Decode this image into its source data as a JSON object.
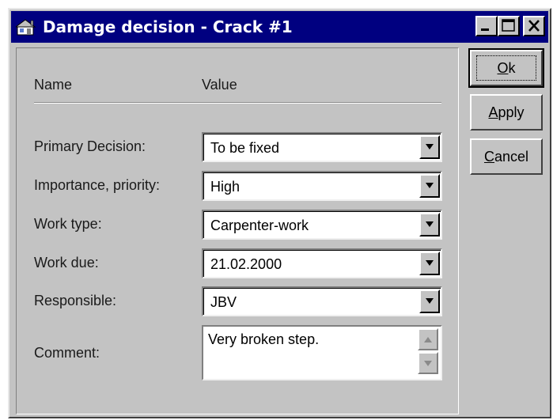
{
  "window": {
    "title": "Damage decision - Crack #1",
    "icons": {
      "app": "house-icon",
      "minimize": "minimize-icon",
      "maximize": "maximize-icon",
      "close": "close-icon"
    }
  },
  "headers": {
    "name": "Name",
    "value": "Value"
  },
  "fields": [
    {
      "label": "Primary Decision:",
      "value": "To be fixed"
    },
    {
      "label": "Importance, priority:",
      "value": "High"
    },
    {
      "label": "Work type:",
      "value": "Carpenter-work"
    },
    {
      "label": "Work due:",
      "value": "21.02.2000"
    },
    {
      "label": "Responsible:",
      "value": "JBV"
    }
  ],
  "comment": {
    "label": "Comment:",
    "value": "Very broken step."
  },
  "buttons": {
    "ok": {
      "mnemonic": "O",
      "rest": "k"
    },
    "apply": {
      "mnemonic": "A",
      "rest": "pply"
    },
    "cancel": {
      "mnemonic": "C",
      "rest": "ancel"
    }
  }
}
